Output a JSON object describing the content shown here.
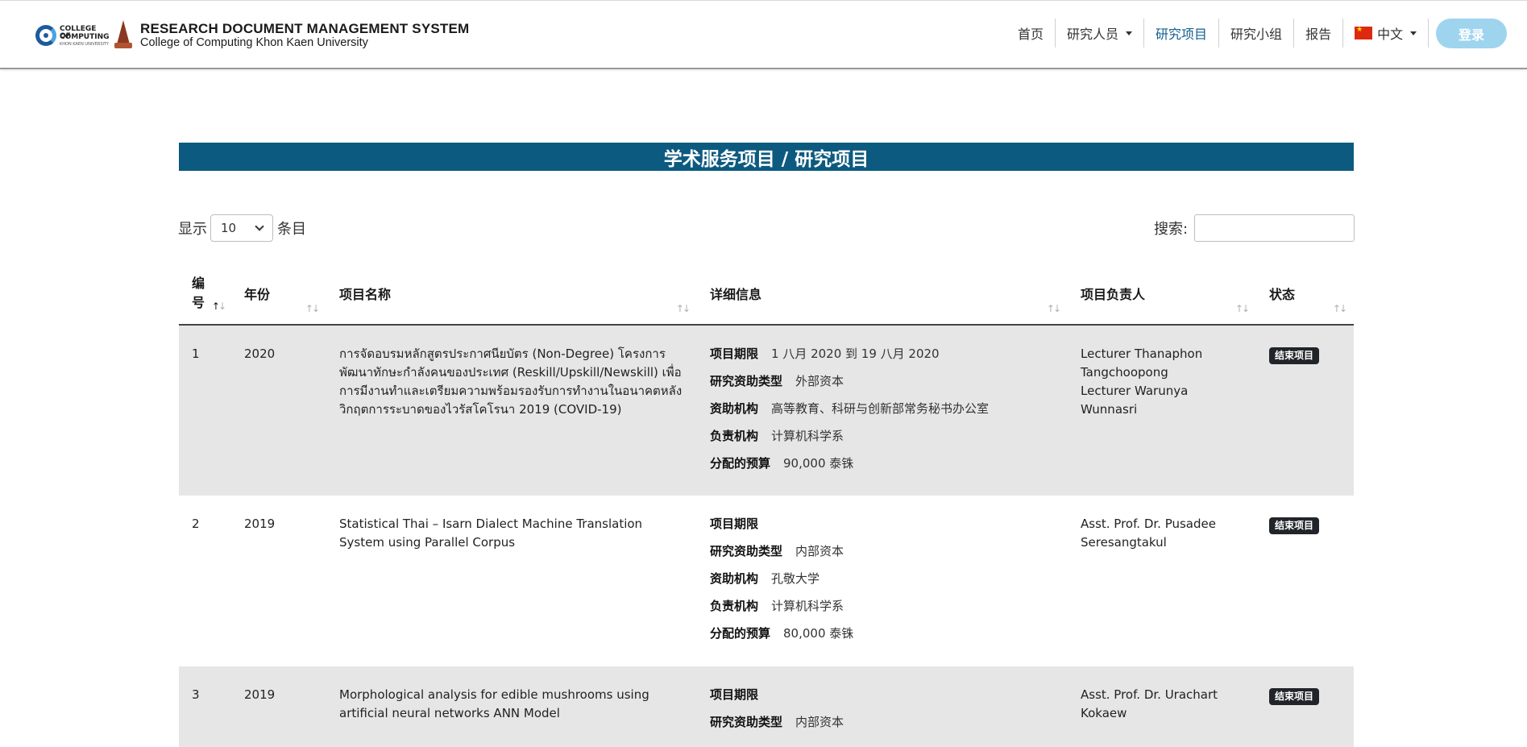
{
  "header": {
    "logo_text": [
      "COLLEGE OF",
      "COMPUTING",
      "KHON KAEN UNIVERSITY"
    ],
    "title": "RESEARCH DOCUMENT MANAGEMENT SYSTEM",
    "subtitle": "College of Computing Khon Kaen University",
    "nav": [
      {
        "label": "首页",
        "dropdown": false,
        "active": false
      },
      {
        "label": "研究人员",
        "dropdown": true,
        "active": false
      },
      {
        "label": "研究项目",
        "dropdown": false,
        "active": true
      },
      {
        "label": "研究小组",
        "dropdown": false,
        "active": false
      },
      {
        "label": "报告",
        "dropdown": false,
        "active": false
      },
      {
        "label": "中文",
        "dropdown": true,
        "active": false,
        "icon": "china-flag-icon"
      }
    ],
    "login_label": "登录"
  },
  "page_title": "学术服务项目 / 研究项目",
  "controls": {
    "show_label": "显示",
    "page_length": "10",
    "entries_label": "条目",
    "search_label": "搜索:",
    "search_value": ""
  },
  "table": {
    "columns": [
      "编号",
      "年份",
      "项目名称",
      "详细信息",
      "项目负责人",
      "状态"
    ],
    "rows": [
      {
        "no": "1",
        "year": "2020",
        "name": "การจัดอบรมหลักสูตรประกาศนียบัตร (Non-Degree) โครงการพัฒนาทักษะกำลังคนของประเทศ (Reskill/Upskill/Newskill) เพื่อการมีงานทำและเตรียมความพร้อมรองรับการทำงานในอนาคตหลังวิกฤตการระบาดของไวรัสโคโรนา 2019 (COVID-19)",
        "details": [
          {
            "label": "项目期限",
            "value": "1 八月 2020 到 19 八月 2020"
          },
          {
            "label": "研究资助类型",
            "value": "外部资本"
          },
          {
            "label": "资助机构",
            "value": "高等教育、科研与创新部常务秘书办公室"
          },
          {
            "label": "负责机构",
            "value": "计算机科学系"
          },
          {
            "label": "分配的预算",
            "value": "90,000 泰铢"
          }
        ],
        "leads": [
          "Lecturer Thanaphon Tangchoopong",
          "Lecturer Warunya Wunnasri"
        ],
        "status": "结束项目"
      },
      {
        "no": "2",
        "year": "2019",
        "name": "Statistical Thai – Isarn Dialect Machine Translation System using Parallel Corpus",
        "details": [
          {
            "label": "项目期限",
            "value": ""
          },
          {
            "label": "研究资助类型",
            "value": "内部资本"
          },
          {
            "label": "资助机构",
            "value": "孔敬大学"
          },
          {
            "label": "负责机构",
            "value": "计算机科学系"
          },
          {
            "label": "分配的预算",
            "value": "80,000 泰铢"
          }
        ],
        "leads": [
          "Asst. Prof. Dr. Pusadee Seresangtakul"
        ],
        "status": "结束项目"
      },
      {
        "no": "3",
        "year": "2019",
        "name": "Morphological analysis for edible mushrooms using artificial neural networks ANN Model",
        "details": [
          {
            "label": "项目期限",
            "value": ""
          },
          {
            "label": "研究资助类型",
            "value": "内部资本"
          }
        ],
        "leads": [
          "Asst. Prof. Dr. Urachart Kokaew"
        ],
        "status": "结束项目"
      }
    ]
  }
}
